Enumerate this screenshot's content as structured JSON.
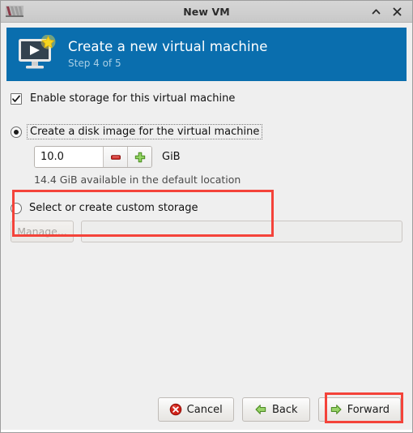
{
  "window": {
    "title": "New VM",
    "icon": "virt-manager-icon",
    "controls": [
      {
        "name": "maximize-button",
        "glyph": "^"
      },
      {
        "name": "close-button",
        "glyph": "✕"
      }
    ]
  },
  "banner": {
    "icon": "new-vm-monitor-star-icon",
    "title": "Create a new virtual machine",
    "subtitle": "Step 4 of 5",
    "background_color": "#0a6eae",
    "title_color": "#ffffff",
    "subtitle_color": "#a9cfe5"
  },
  "storage": {
    "enable_checkbox": {
      "label": "Enable storage for this virtual machine",
      "checked": true
    },
    "disk_image_option": {
      "label": "Create a disk image for the virtual machine",
      "selected": true,
      "focused": true
    },
    "size": {
      "value": "10.0",
      "unit": "GiB",
      "decrement_icon": "minus-icon",
      "increment_icon": "plus-icon",
      "decrement_color": "#cf2a26",
      "increment_color": "#73c043"
    },
    "available_hint": "14.4 GiB available in the default location",
    "custom_option": {
      "label": "Select or create custom storage",
      "selected": false
    },
    "manage_button": {
      "label": "Manage...",
      "enabled": false
    },
    "custom_path_field": {
      "value": "",
      "placeholder": "",
      "enabled": false
    }
  },
  "footer": {
    "cancel": {
      "label": "Cancel",
      "icon": "cancel-circle-icon"
    },
    "back": {
      "label": "Back",
      "icon": "arrow-left-icon"
    },
    "forward": {
      "label": "Forward",
      "icon": "arrow-right-icon"
    }
  },
  "annotations": {
    "highlight_color": "#f4433a",
    "regions": [
      "disk-image-section",
      "forward-button"
    ]
  }
}
